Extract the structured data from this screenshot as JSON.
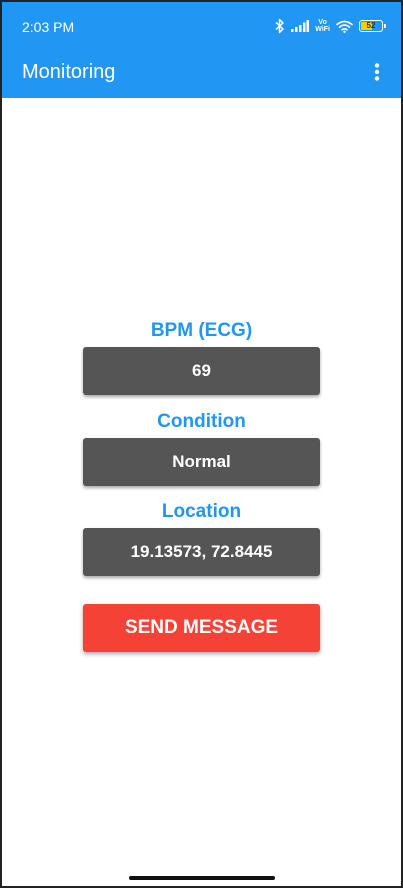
{
  "status_bar": {
    "time": "2:03 PM",
    "battery_level": "52",
    "vowifi_line1": "Vo",
    "vowifi_line2": "WiFi",
    "icons": [
      "bluetooth-icon",
      "signal-icon",
      "vowifi-icon",
      "wifi-icon",
      "battery-icon"
    ]
  },
  "app_bar": {
    "title": "Monitoring",
    "menu_icon": "more-vertical-icon",
    "color": "#2196f3"
  },
  "readings": {
    "bpm_label": "BPM (ECG)",
    "bpm_value": "69",
    "condition_label": "Condition",
    "condition_value": "Normal",
    "location_label": "Location",
    "location_value": "19.13573, 72.8445"
  },
  "actions": {
    "send_label": "SEND MESSAGE",
    "send_color": "#f44336"
  }
}
